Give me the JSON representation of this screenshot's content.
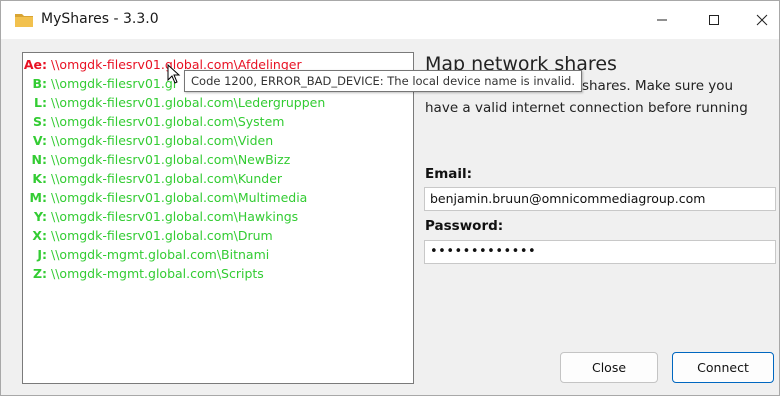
{
  "window": {
    "title": "MyShares - 3.3.0"
  },
  "shares": [
    {
      "letter": "Ae:",
      "path": "\\\\omgdk-filesrv01.global.com\\Afdelinger",
      "color": "#e81123"
    },
    {
      "letter": "B:",
      "path": "\\\\omgdk-filesrv01.gl",
      "color": "#33cc33"
    },
    {
      "letter": "L:",
      "path": "\\\\omgdk-filesrv01.global.com\\Ledergruppen",
      "color": "#33cc33"
    },
    {
      "letter": "S:",
      "path": "\\\\omgdk-filesrv01.global.com\\System",
      "color": "#33cc33"
    },
    {
      "letter": "V:",
      "path": "\\\\omgdk-filesrv01.global.com\\Viden",
      "color": "#33cc33"
    },
    {
      "letter": "N:",
      "path": "\\\\omgdk-filesrv01.global.com\\NewBizz",
      "color": "#33cc33"
    },
    {
      "letter": "K:",
      "path": "\\\\omgdk-filesrv01.global.com\\Kunder",
      "color": "#33cc33"
    },
    {
      "letter": "M:",
      "path": "\\\\omgdk-filesrv01.global.com\\Multimedia",
      "color": "#33cc33"
    },
    {
      "letter": "Y:",
      "path": "\\\\omgdk-filesrv01.global.com\\Hawkings",
      "color": "#33cc33"
    },
    {
      "letter": "X:",
      "path": "\\\\omgdk-filesrv01.global.com\\Drum",
      "color": "#33cc33"
    },
    {
      "letter": "J:",
      "path": "\\\\omgdk-mgmt.global.com\\Bitnami",
      "color": "#33cc33"
    },
    {
      "letter": "Z:",
      "path": "\\\\omgdk-mgmt.global.com\\Scripts",
      "color": "#33cc33"
    }
  ],
  "tooltip": {
    "text": "Code 1200, ERROR_BAD_DEVICE: The local device name is invalid."
  },
  "panel": {
    "heading": "Map network shares",
    "description_line1": "work shares. Make sure you",
    "description_line2": "have a valid internet connection before running",
    "email_label": "Email:",
    "email_value": "benjamin.bruun@omnicommediagroup.com",
    "password_label": "Password:",
    "password_value": "•••••••••••••"
  },
  "buttons": {
    "close_label": "Close",
    "connect_label": "Connect"
  },
  "colors": {
    "error": "#e81123",
    "mapped": "#33cc33",
    "accent": "#0067c0"
  }
}
